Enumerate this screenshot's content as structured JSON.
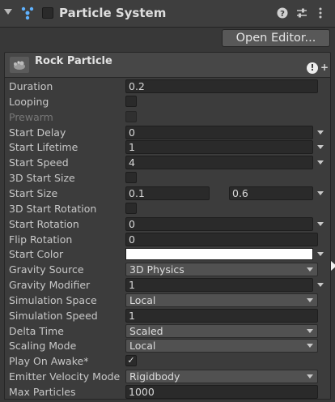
{
  "header": {
    "title": "Particle System",
    "icons": [
      "fold-arrow-icon",
      "particle-system-icon",
      "help-icon",
      "preset-sliders-icon",
      "kebab-menu-icon"
    ]
  },
  "open_editor_label": "Open Editor...",
  "system": {
    "name": "Rock Particle",
    "warning_symbol": "!",
    "add_symbol": "+"
  },
  "properties": [
    {
      "label": "Duration",
      "type": "number",
      "value": "0.2"
    },
    {
      "label": "Looping",
      "type": "checkbox",
      "checked": false
    },
    {
      "label": "Prewarm",
      "type": "checkbox",
      "checked": false,
      "disabled": true
    },
    {
      "label": "Start Delay",
      "type": "number-curve",
      "value": "0"
    },
    {
      "label": "Start Lifetime",
      "type": "number-curve",
      "value": "1"
    },
    {
      "label": "Start Speed",
      "type": "number-curve",
      "value": "4"
    },
    {
      "label": "3D Start Size",
      "type": "checkbox",
      "checked": false
    },
    {
      "label": "Start Size",
      "type": "range-curve",
      "min": "0.1",
      "max": "0.6"
    },
    {
      "label": "3D Start Rotation",
      "type": "checkbox",
      "checked": false
    },
    {
      "label": "Start Rotation",
      "type": "number-curve",
      "value": "0"
    },
    {
      "label": "Flip Rotation",
      "type": "number",
      "value": "0"
    },
    {
      "label": "Start Color",
      "type": "color-curve",
      "color": "#ffffff"
    },
    {
      "label": "Gravity Source",
      "type": "dropdown",
      "value": "3D Physics"
    },
    {
      "label": "Gravity Modifier",
      "type": "number-curve",
      "value": "1"
    },
    {
      "label": "Simulation Space",
      "type": "dropdown",
      "value": "Local"
    },
    {
      "label": "Simulation Speed",
      "type": "number",
      "value": "1"
    },
    {
      "label": "Delta Time",
      "type": "dropdown",
      "value": "Scaled"
    },
    {
      "label": "Scaling Mode",
      "type": "dropdown",
      "value": "Local"
    },
    {
      "label": "Play On Awake*",
      "type": "checkbox",
      "checked": true,
      "check_glyph": "✓"
    },
    {
      "label": "Emitter Velocity Mode",
      "type": "dropdown",
      "value": "Rigidbody"
    },
    {
      "label": "Max Particles",
      "type": "number",
      "value": "1000"
    }
  ]
}
